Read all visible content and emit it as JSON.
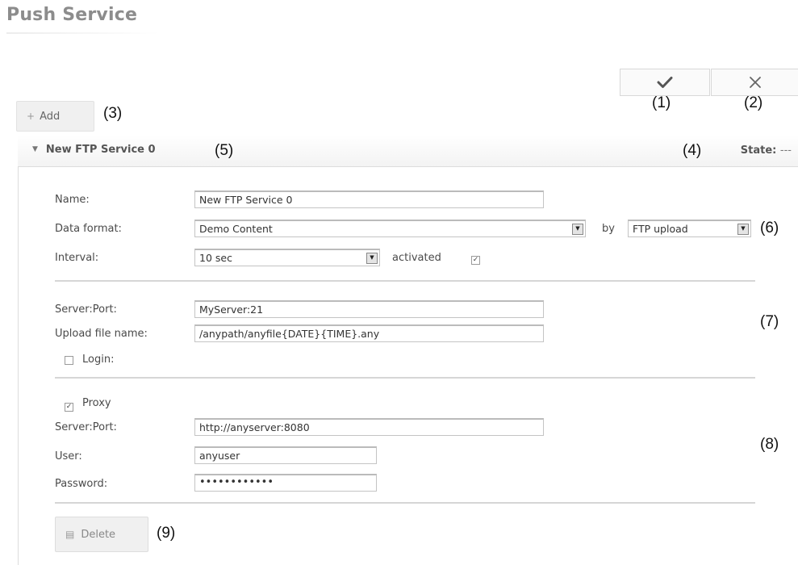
{
  "page": {
    "title": "Push Service"
  },
  "toolbar": {
    "confirm_icon": "checkmark-icon",
    "cancel_icon": "close-icon"
  },
  "annotations": {
    "a1": "(1)",
    "a2": "(2)",
    "a3": "(3)",
    "a4": "(4)",
    "a5": "(5)",
    "a6": "(6)",
    "a7": "(7)",
    "a8": "(8)",
    "a9": "(9)"
  },
  "add_button": {
    "label": "Add",
    "icon": "plus-icon"
  },
  "service": {
    "title": "New FTP Service 0",
    "state_label": "State:",
    "state_value": "---",
    "name": {
      "label": "Name:",
      "value": "New FTP Service 0"
    },
    "data_format": {
      "label": "Data format:",
      "value": "Demo Content"
    },
    "by_label": "by",
    "method": {
      "value": "FTP upload"
    },
    "interval": {
      "label": "Interval:",
      "value": "10 sec"
    },
    "activated": {
      "label": "activated",
      "checked": true
    },
    "server_port": {
      "label": "Server:Port:",
      "value": "MyServer:21"
    },
    "upload_file_name": {
      "label": "Upload file name:",
      "value": "/anypath/anyfile{DATE}{TIME}.any"
    },
    "login": {
      "label": "Login:",
      "checked": false
    },
    "proxy": {
      "label": "Proxy",
      "checked": true,
      "server_port": {
        "label": "Server:Port:",
        "value": "http://anyserver:8080"
      },
      "user": {
        "label": "User:",
        "value": "anyuser"
      },
      "password": {
        "label": "Password:",
        "value": "••••••••••••"
      }
    },
    "delete_button": {
      "label": "Delete",
      "icon": "trash-icon"
    }
  }
}
